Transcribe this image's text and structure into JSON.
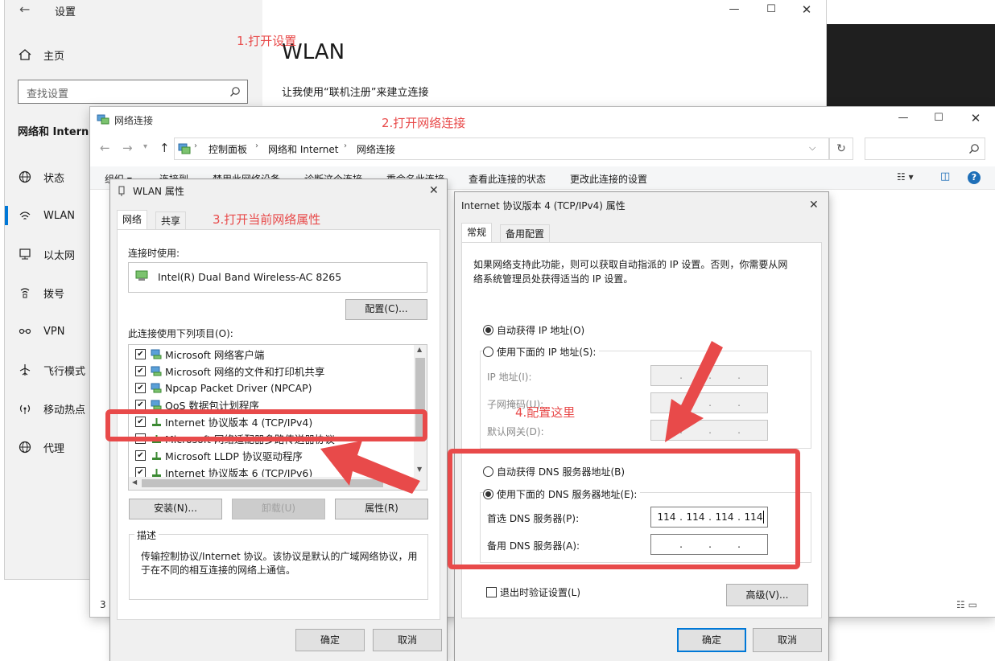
{
  "settings": {
    "title": "设置",
    "home": "主页",
    "search_placeholder": "查找设置",
    "section": "网络和 Interne",
    "nav": [
      {
        "label": "状态",
        "icon": "globe-icon"
      },
      {
        "label": "WLAN",
        "icon": "wifi-icon"
      },
      {
        "label": "以太网",
        "icon": "ethernet-icon"
      },
      {
        "label": "拨号",
        "icon": "dialup-icon"
      },
      {
        "label": "VPN",
        "icon": "vpn-icon"
      },
      {
        "label": "飞行模式",
        "icon": "airplane-icon"
      },
      {
        "label": "移动热点",
        "icon": "hotspot-icon"
      },
      {
        "label": "代理",
        "icon": "proxy-globe-icon"
      }
    ],
    "page_title": "WLAN",
    "subtitle": "让我使用“联机注册”来建立连接"
  },
  "annotations": {
    "step1": "1.打开设置",
    "step2": "2.打开网络连接",
    "step3": "3.打开当前网络属性",
    "step4": "4.配置这里"
  },
  "netconn": {
    "title": "网络连接",
    "breadcrumb": [
      "控制面板",
      "网络和 Internet",
      "网络连接"
    ],
    "toolbar": [
      "组织 ▾",
      "连接到",
      "禁用此网络设备",
      "诊断这个连接",
      "重命名此连接",
      "查看此连接的状态",
      "更改此连接的设置"
    ],
    "status_count": "3"
  },
  "wlan_props": {
    "title": "WLAN 属性",
    "tabs": [
      "网络",
      "共享"
    ],
    "connect_using_label": "连接时使用:",
    "adapter": "Intel(R) Dual Band Wireless-AC 8265",
    "configure_button": "配置(C)...",
    "items_label": "此连接使用下列项目(O):",
    "items": [
      {
        "label": "Microsoft 网络客户端",
        "checked": true
      },
      {
        "label": "Microsoft 网络的文件和打印机共享",
        "checked": true
      },
      {
        "label": "Npcap Packet Driver (NPCAP)",
        "checked": true
      },
      {
        "label": "QoS 数据包计划程序",
        "checked": true
      },
      {
        "label": "Internet 协议版本 4 (TCP/IPv4)",
        "checked": true
      },
      {
        "label": "Microsoft 网络适配器多路传送器协议",
        "checked": false
      },
      {
        "label": "Microsoft LLDP 协议驱动程序",
        "checked": true
      },
      {
        "label": "Internet 协议版本 6 (TCP/IPv6)",
        "checked": true
      }
    ],
    "install_button": "安装(N)...",
    "uninstall_button": "卸载(U)",
    "properties_button": "属性(R)",
    "desc_label": "描述",
    "desc_text_1": "传输控制协议/Internet 协议。该协议是默认的广域网络协议，用",
    "desc_text_2": "于在不同的相互连接的网络上通信。",
    "ok_button": "确定",
    "cancel_button": "取消"
  },
  "ipv4_props": {
    "title": "Internet 协议版本 4 (TCP/IPv4) 属性",
    "tabs": [
      "常规",
      "备用配置"
    ],
    "info_1": "如果网络支持此功能，则可以获取自动指派的 IP 设置。否则，你需要从网",
    "info_2": "络系统管理员处获得适当的 IP 设置。",
    "auto_ip": "自动获得 IP 地址(O)",
    "manual_ip": "使用下面的 IP 地址(S):",
    "ip_label": "IP 地址(I):",
    "mask_label": "子网掩码(U):",
    "gateway_label": "默认网关(D):",
    "auto_dns": "自动获得 DNS 服务器地址(B)",
    "manual_dns": "使用下面的 DNS 服务器地址(E):",
    "preferred_dns_label": "首选 DNS 服务器(P):",
    "preferred_dns": [
      "114",
      "114",
      "114",
      "114"
    ],
    "alternate_dns_label": "备用 DNS 服务器(A):",
    "validate_label": "退出时验证设置(L)",
    "advanced_button": "高级(V)...",
    "ok_button": "确定",
    "cancel_button": "取消"
  },
  "colors": {
    "accent": "#0078d7",
    "annotation": "#e84a4a"
  }
}
